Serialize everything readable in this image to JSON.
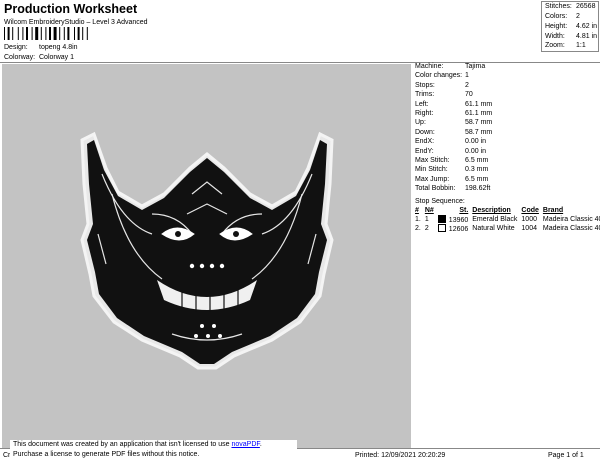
{
  "header": {
    "title": "Production Worksheet",
    "software": "Wilcom EmbroideryStudio – Level 3 Advanced",
    "design_label": "Design:",
    "design_value": "topeng 4.8in",
    "colorway_label": "Colorway:",
    "colorway_value": "Colorway 1"
  },
  "summary": [
    {
      "label": "Stitches:",
      "value": "26568"
    },
    {
      "label": "Colors:",
      "value": "2"
    },
    {
      "label": "Height:",
      "value": "4.62 in"
    },
    {
      "label": "Width:",
      "value": "4.81 in"
    },
    {
      "label": "Zoom:",
      "value": "1:1"
    }
  ],
  "machine_stats": [
    {
      "label": "Machine:",
      "value": "Tajima"
    },
    {
      "label": "Color changes:",
      "value": "1"
    },
    {
      "label": "Stops:",
      "value": "2"
    },
    {
      "label": "Trims:",
      "value": "70"
    },
    {
      "label": "Left:",
      "value": "61.1 mm"
    },
    {
      "label": "Right:",
      "value": "61.1 mm"
    },
    {
      "label": "Up:",
      "value": "58.7 mm"
    },
    {
      "label": "Down:",
      "value": "58.7 mm"
    },
    {
      "label": "EndX:",
      "value": "0.00 in"
    },
    {
      "label": "EndY:",
      "value": "0.00 in"
    },
    {
      "label": "Max Stitch:",
      "value": "6.5 mm"
    },
    {
      "label": "Min Stitch:",
      "value": "0.3 mm"
    },
    {
      "label": "Max Jump:",
      "value": "6.5 mm"
    },
    {
      "label": "Total Bobbin:",
      "value": "198.62ft"
    }
  ],
  "stop_sequence": {
    "label": "Stop Sequence:",
    "columns": [
      "#",
      "N#",
      "St.",
      "Description",
      "Code",
      "Brand"
    ],
    "rows": [
      {
        "num": "1.",
        "needle": "1",
        "swatch": "#000000",
        "stitches": "13960",
        "description": "Emerald Black",
        "code": "1000",
        "brand": "Madeira Classic 40"
      },
      {
        "num": "2.",
        "needle": "2",
        "swatch": "#ffffff",
        "stitches": "12606",
        "description": "Natural White",
        "code": "1004",
        "brand": "Madeira Classic 40"
      }
    ]
  },
  "notice": {
    "line1_prefix": "This document was created by an application that isn't licensed to use ",
    "link": "novaPDF",
    "line1_suffix": ".",
    "line2": "Purchase a license to generate PDF files without this notice."
  },
  "footer": {
    "left": "Cr",
    "printed": "Printed: 12/09/2021 20:20:29",
    "page": "Page 1 of 1"
  },
  "colors": {
    "preview_bg": "#c3c3c3",
    "thread_black": "#000000",
    "thread_white": "#ffffff"
  }
}
